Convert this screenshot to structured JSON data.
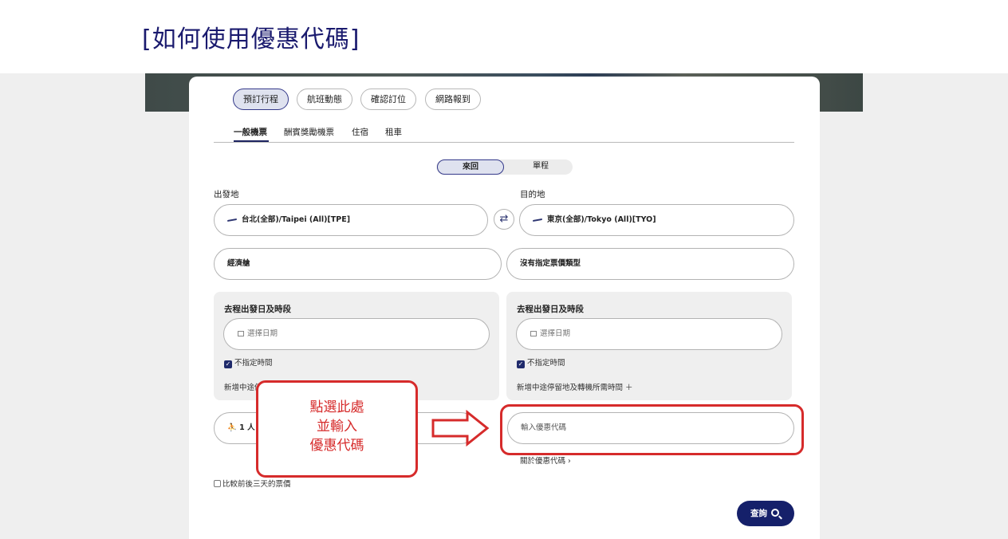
{
  "page_title": "[如何使用優惠代碼]",
  "main_tabs": [
    "預訂行程",
    "航班動態",
    "確認訂位",
    "網路報到"
  ],
  "sub_tabs": [
    "一般機票",
    "酬賓獎勵機票",
    "住宿",
    "租車"
  ],
  "trip_type": {
    "round_trip": "來回",
    "one_way": "單程"
  },
  "origin": {
    "label": "出發地",
    "value": "台北(全部)/Taipei (All)[TPE]"
  },
  "destination": {
    "label": "目的地",
    "value": "東京(全部)/Tokyo (All)[TYO]"
  },
  "swap_icon": "⇄",
  "cabin": "經濟艙",
  "fare_type": "沒有指定票價類型",
  "outbound": {
    "label": "去程出發日及時段",
    "placeholder": "選擇日期",
    "any_time": "不指定時間",
    "add_stopover": "新增中途停"
  },
  "return": {
    "label": "去程出發日及時段",
    "placeholder": "選擇日期",
    "any_time": "不指定時間",
    "add_stopover": "新增中途停留地及轉機所需時間 ＋"
  },
  "passengers": "1 人",
  "promo": {
    "placeholder": "輸入優惠代碼",
    "link": "關於優惠代碼 ›"
  },
  "compare_label": "比較前後三天的票價",
  "callout_lines": [
    "點選此處",
    "並輸入",
    "優惠代碼"
  ],
  "search_label": "查詢",
  "accent_color": "#15206a",
  "highlight_color": "#d62b2b"
}
